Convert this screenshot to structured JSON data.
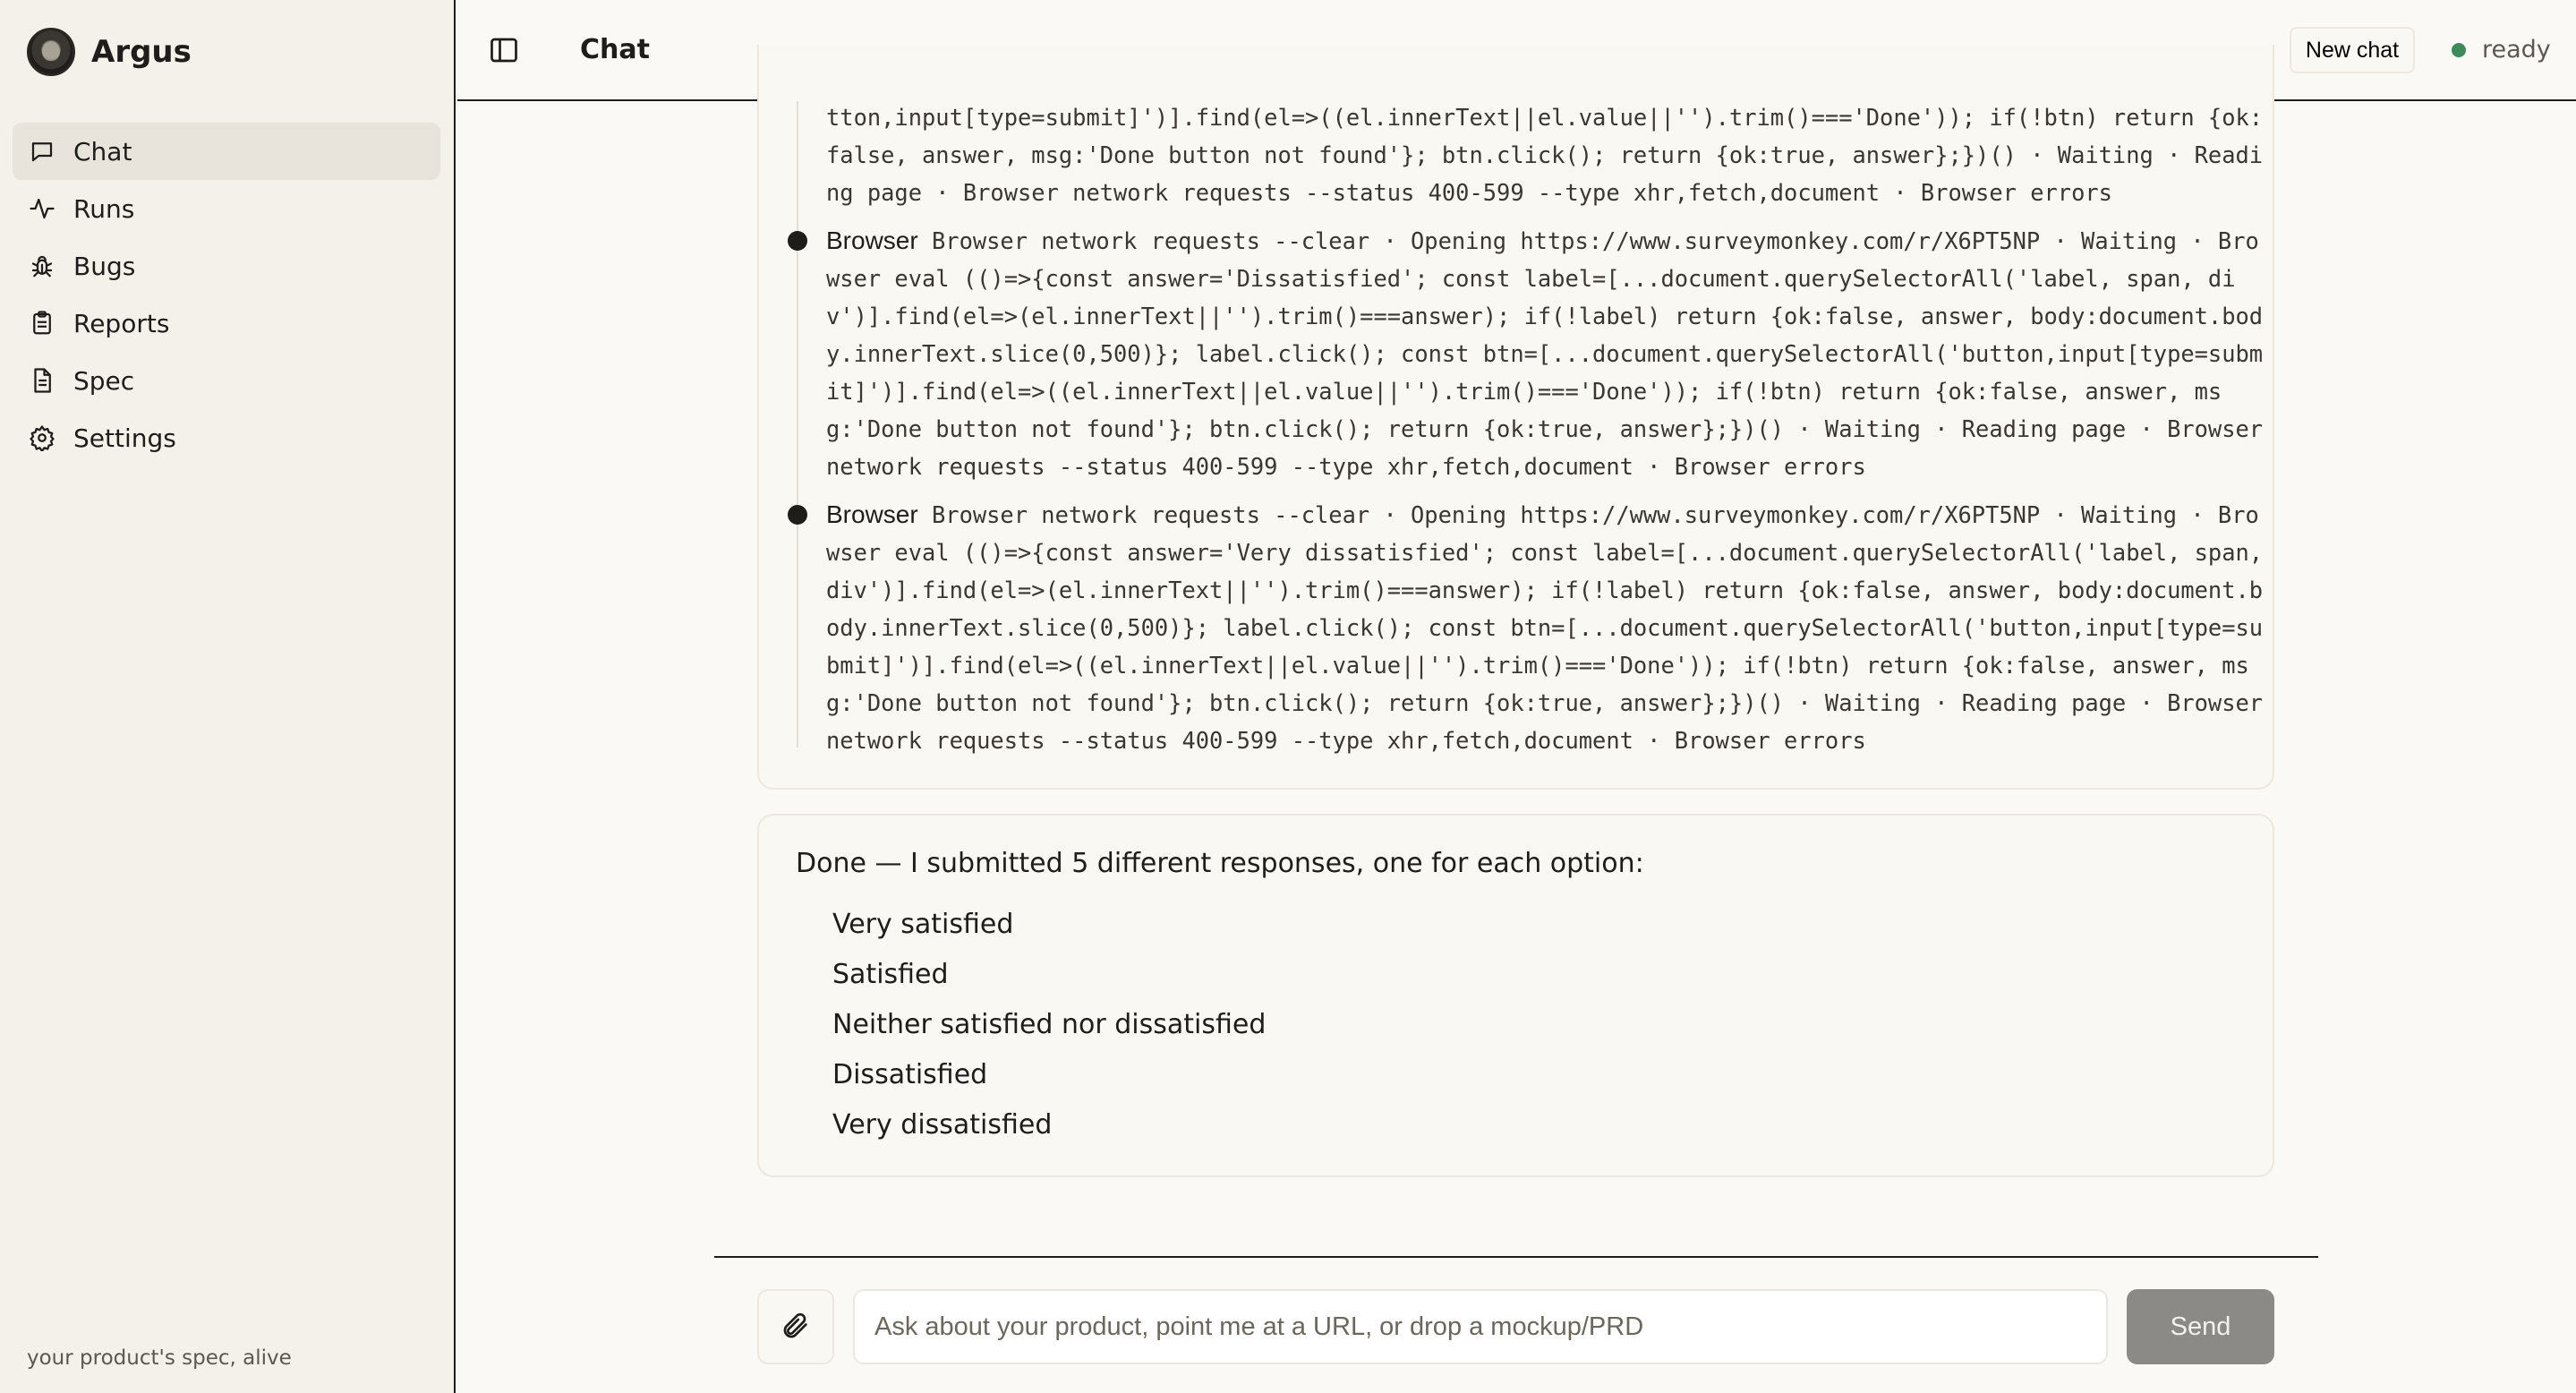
{
  "app": {
    "name": "Argus",
    "tagline": "your product's spec, alive"
  },
  "sidebar": {
    "items": [
      {
        "label": "Chat",
        "icon": "chat-icon",
        "active": true
      },
      {
        "label": "Runs",
        "icon": "activity-icon"
      },
      {
        "label": "Bugs",
        "icon": "bug-icon"
      },
      {
        "label": "Reports",
        "icon": "clipboard-icon"
      },
      {
        "label": "Spec",
        "icon": "document-icon"
      },
      {
        "label": "Settings",
        "icon": "gear-icon"
      }
    ]
  },
  "header": {
    "title": "Chat",
    "new_chat_label": "New chat",
    "status": "ready",
    "status_color": "#3d8a5a"
  },
  "trace": {
    "continuation_lines": [
      "tton,input[type=submit]')].find(el=>((el.innerText||el.value||'').trim()==='Done')); if(!btn) return {ok:",
      "false, answer, msg:'Done button not found'}; btn.click(); return {ok:true, answer};})() · Waiting · Readi",
      "ng page · Browser network requests --status 400-599 --type xhr,fetch,document · Browser errors"
    ],
    "entries": [
      {
        "label": "Browser",
        "first_line": "Browser network requests --clear · Opening https://www.surveymonkey.com/r/X6PT5NP · Waiting · Bro",
        "lines": [
          "wser eval (()=>{const answer='Dissatisfied'; const label=[...document.querySelectorAll('label, span, di",
          "v')].find(el=>(el.innerText||'').trim()===answer); if(!label) return {ok:false, answer, body:document.bod",
          "y.innerText.slice(0,500)}; label.click(); const btn=[...document.querySelectorAll('button,input[type=subm",
          "it]')].find(el=>((el.innerText||el.value||'').trim()==='Done')); if(!btn) return {ok:false, answer, ms",
          "g:'Done button not found'}; btn.click(); return {ok:true, answer};})() · Waiting · Reading page · Browser",
          "network requests --status 400-599 --type xhr,fetch,document · Browser errors"
        ]
      },
      {
        "label": "Browser",
        "first_line": "Browser network requests --clear · Opening https://www.surveymonkey.com/r/X6PT5NP · Waiting · Bro",
        "lines": [
          "wser eval (()=>{const answer='Very dissatisfied'; const label=[...document.querySelectorAll('label, span,",
          "div')].find(el=>(el.innerText||'').trim()===answer); if(!label) return {ok:false, answer, body:document.b",
          "ody.innerText.slice(0,500)}; label.click(); const btn=[...document.querySelectorAll('button,input[type=su",
          "bmit]')].find(el=>((el.innerText||el.value||'').trim()==='Done')); if(!btn) return {ok:false, answer, ms",
          "g:'Done button not found'}; btn.click(); return {ok:true, answer};})() · Waiting · Reading page · Browser",
          "network requests --status 400-599 --type xhr,fetch,document · Browser errors"
        ]
      }
    ]
  },
  "answer": {
    "intro": "Done — I submitted 5 different responses, one for each option:",
    "items": [
      "Very satisfied",
      "Satisfied",
      "Neither satisfied nor dissatisfied",
      "Dissatisfied",
      "Very dissatisfied"
    ]
  },
  "composer": {
    "placeholder": "Ask about your product, point me at a URL, or drop a mockup/PRD",
    "send_label": "Send",
    "attach_icon": "paperclip-icon"
  }
}
